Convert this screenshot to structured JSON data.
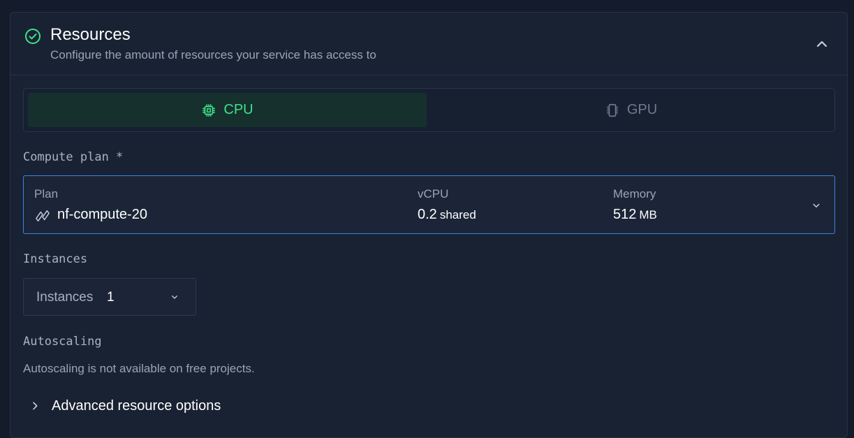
{
  "section": {
    "title": "Resources",
    "subtitle": "Configure the amount of resources your service has access to",
    "status_icon": "check-circle-icon",
    "collapse_icon": "chevron-up-icon"
  },
  "resource_type": {
    "tabs": [
      {
        "label": "CPU",
        "icon": "chip-icon",
        "selected": true
      },
      {
        "label": "GPU",
        "icon": "gpu-card-icon",
        "selected": false
      }
    ]
  },
  "compute_plan": {
    "label": "Compute plan *",
    "plan_label": "Plan",
    "plan_value": "nf-compute-20",
    "plan_icon": "northflank-logo-icon",
    "vcpu_label": "vCPU",
    "vcpu_value": "0.2",
    "vcpu_unit": "shared",
    "memory_label": "Memory",
    "memory_value": "512",
    "memory_unit": "MB"
  },
  "instances": {
    "label": "Instances",
    "field_label": "Instances",
    "value": "1"
  },
  "autoscaling": {
    "label": "Autoscaling",
    "note": "Autoscaling is not available on free projects."
  },
  "advanced": {
    "label": "Advanced resource options"
  },
  "colors": {
    "accent_green": "#3ee38a",
    "focus_blue": "#3c82e6",
    "background": "#141b2b",
    "panel": "#192233"
  }
}
